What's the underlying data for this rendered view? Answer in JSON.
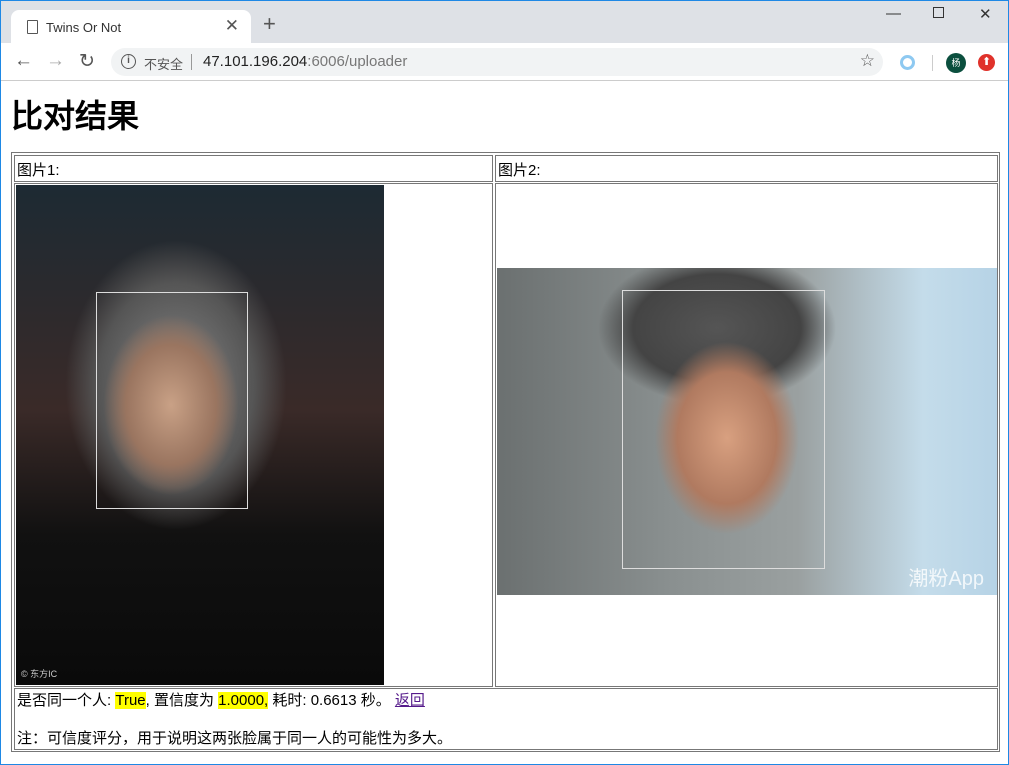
{
  "browser": {
    "tab_title": "Twins Or Not",
    "url_host": "47.101.196.204",
    "url_rest": ":6006/uploader",
    "security_label": "不安全",
    "profile_initial": "杨"
  },
  "page": {
    "heading": "比对结果",
    "image1_label": "图片1:",
    "image2_label": "图片2:",
    "image1_watermark": "© 东方IC",
    "image2_watermark": "潮粉App"
  },
  "result": {
    "same_person_label": "是否同一个人: ",
    "same_person_value": "True",
    "confidence_label": ", 置信度为 ",
    "confidence_value": "1.0000,",
    "time_label": " 耗时: 0.6613 秒。 ",
    "back_link": "返回",
    "note": "注：可信度评分，用于说明这两张脸属于同一人的可能性为多大。"
  }
}
